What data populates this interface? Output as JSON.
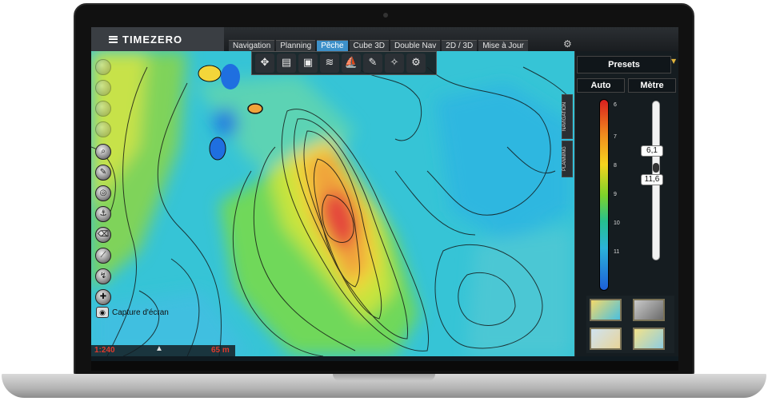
{
  "app": {
    "name": "TIMEZERO",
    "tabs": [
      "Navigation",
      "Planning",
      "Pêche",
      "Cube 3D",
      "Double Nav",
      "2D / 3D",
      "Mise à Jour"
    ],
    "active_tab": "Pêche"
  },
  "map_toolbar": {
    "icons": [
      "compass-rose-icon",
      "chart-book-icon",
      "layers-icon",
      "fish-icon",
      "fishing-boat-icon",
      "pencil-route-icon",
      "waypoint-icon",
      "gear-icon"
    ]
  },
  "left_toolbar": {
    "capture_label": "Capture d'écran"
  },
  "status": {
    "scale": "1:240",
    "depth": "65 m"
  },
  "side_tabs": [
    "NAVIGATION",
    "PLANNING"
  ],
  "right_panel": {
    "presets_label": "Presets",
    "mode_button": "Auto",
    "unit_button": "Mètre",
    "scale_labels": [
      "6",
      "7",
      "8",
      "9",
      "10",
      "11"
    ],
    "slider_top_value": "6,1",
    "slider_bottom_value": "11,6"
  },
  "colors": {
    "accent": "#3d90c9",
    "depth_high": "#d81f1f",
    "depth_low": "#1d5fd8"
  }
}
